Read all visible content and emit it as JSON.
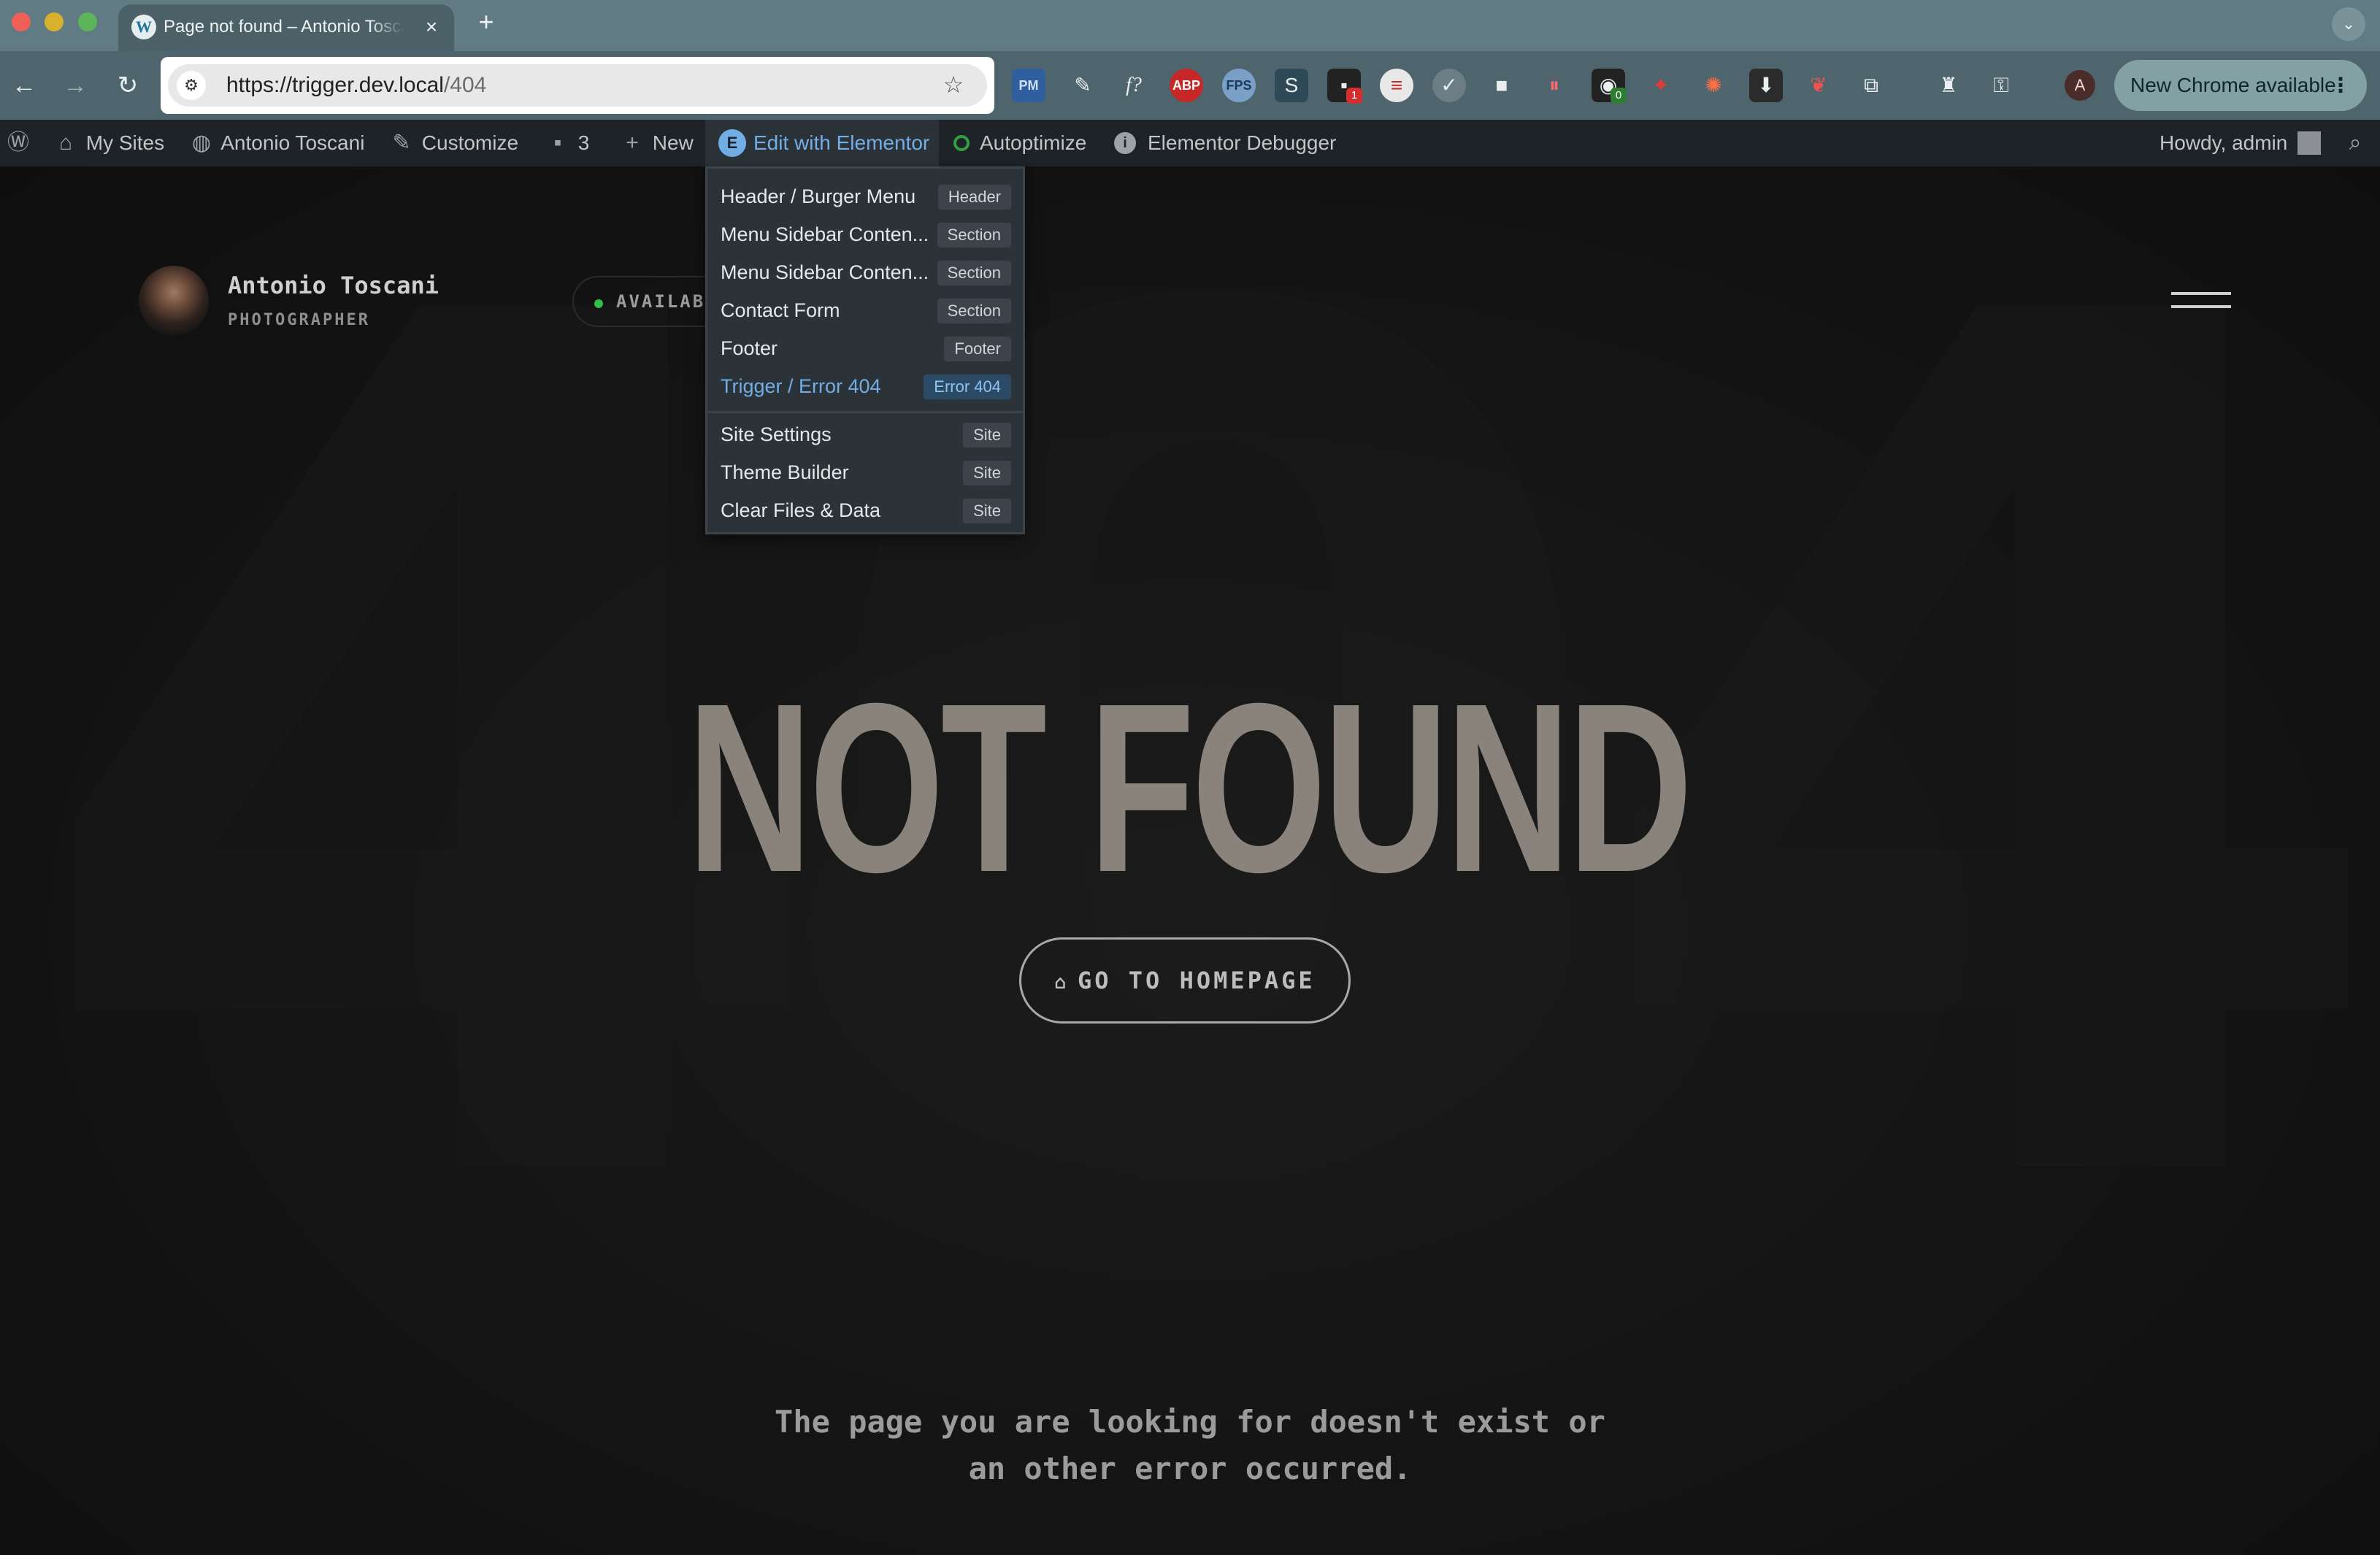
{
  "browser": {
    "tab_title": "Page not found – Antonio Toscani",
    "tab_favicon": "wordpress-icon",
    "url_host": "https://trigger.dev.local",
    "url_path": "/404",
    "update_button": "New Chrome available",
    "profile_initial": "A",
    "extension_badges": [
      "1",
      "0"
    ]
  },
  "adminbar": {
    "my_sites": "My Sites",
    "site_name": "Antonio Toscani",
    "customize": "Customize",
    "comments_count": "3",
    "new": "New",
    "edit_elementor": "Edit with Elementor",
    "autoptimize": "Autoptimize",
    "debugger": "Elementor Debugger",
    "greeting": "Howdy, admin"
  },
  "elementor_menu": {
    "items": [
      {
        "label": "Header / Burger Menu",
        "tag": "Header"
      },
      {
        "label": "Menu Sidebar Conten...",
        "tag": "Section"
      },
      {
        "label": "Menu Sidebar Conten...",
        "tag": "Section"
      },
      {
        "label": "Contact Form",
        "tag": "Section"
      },
      {
        "label": "Footer",
        "tag": "Footer"
      },
      {
        "label": "Trigger / Error 404",
        "tag": "Error 404",
        "current": true
      }
    ],
    "site_items": [
      {
        "label": "Site Settings",
        "tag": "Site"
      },
      {
        "label": "Theme Builder",
        "tag": "Site"
      },
      {
        "label": "Clear Files & Data",
        "tag": "Site"
      }
    ]
  },
  "page": {
    "brand_name": "Antonio Toscani",
    "brand_role": "PHOTOGRAPHER",
    "availability": "AVAILABLE",
    "background_text": "404",
    "title": "NOT FOUND",
    "home_button": "GO TO HOMEPAGE",
    "message_line1": "The page you are looking for doesn't exist or",
    "message_line2": "an other error occurred."
  },
  "colors": {
    "adminbar_bg": "#1d2327",
    "accent_blue": "#72aee6",
    "title_color": "#8a837c",
    "page_bg": "#141414",
    "available_dot": "#2fbf4f"
  }
}
